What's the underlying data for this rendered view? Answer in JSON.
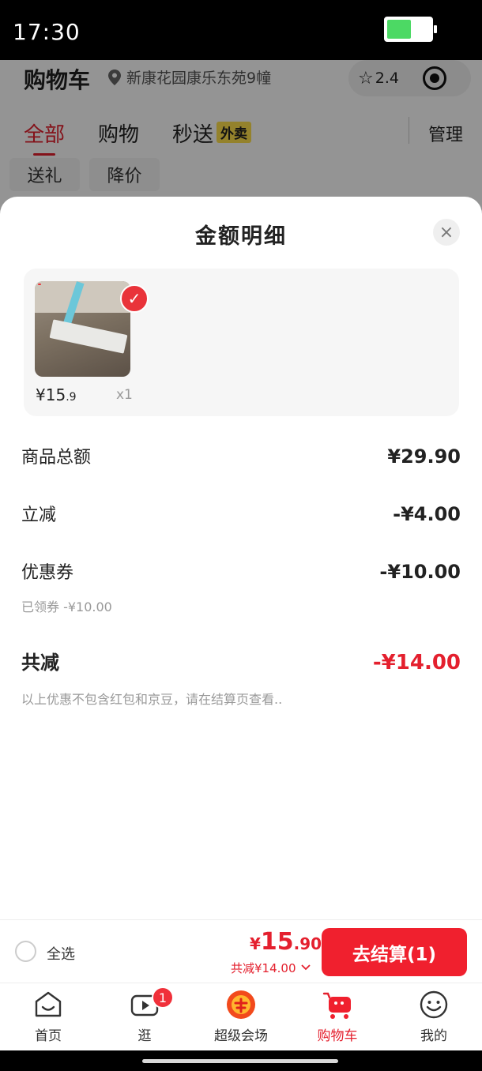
{
  "status_bar": {
    "time": "17:30"
  },
  "background": {
    "title": "购物车",
    "location": "新康花园康乐东苑9幢",
    "rating": "2.4",
    "tabs": [
      "全部",
      "购物",
      "秒送"
    ],
    "takeout_badge": "外卖",
    "manage": "管理",
    "chips": [
      "送礼",
      "降价"
    ]
  },
  "sheet": {
    "title": "金额明细",
    "close_icon": "×",
    "item": {
      "price_main": "¥15",
      "price_decimal": ".9",
      "quantity": "x1"
    },
    "rows": {
      "subtotal": {
        "label": "商品总额",
        "value": "¥29.90"
      },
      "instant_discount": {
        "label": "立减",
        "value": "-¥4.00"
      },
      "coupon": {
        "label": "优惠券",
        "value": "-¥10.00",
        "note": "已领券 -¥10.00"
      },
      "total_discount": {
        "label": "共减",
        "value": "-¥14.00"
      }
    },
    "footnote": "以上优惠不包含红包和京豆，请在结算页查看.."
  },
  "checkout": {
    "select_all": "全选",
    "price_yen": "¥",
    "price_int": "15",
    "price_decimal": ".90",
    "saving": "共减¥14.00",
    "button": "去结算(1)"
  },
  "tabbar": {
    "items": [
      {
        "label": "首页",
        "icon": "home-icon"
      },
      {
        "label": "逛",
        "icon": "video-icon",
        "badge": "1"
      },
      {
        "label": "超级会场",
        "icon": "super-venue-icon"
      },
      {
        "label": "购物车",
        "icon": "cart-icon"
      },
      {
        "label": "我的",
        "icon": "profile-icon"
      }
    ]
  },
  "colors": {
    "accent": "#e4202e",
    "button": "#f0202e"
  }
}
